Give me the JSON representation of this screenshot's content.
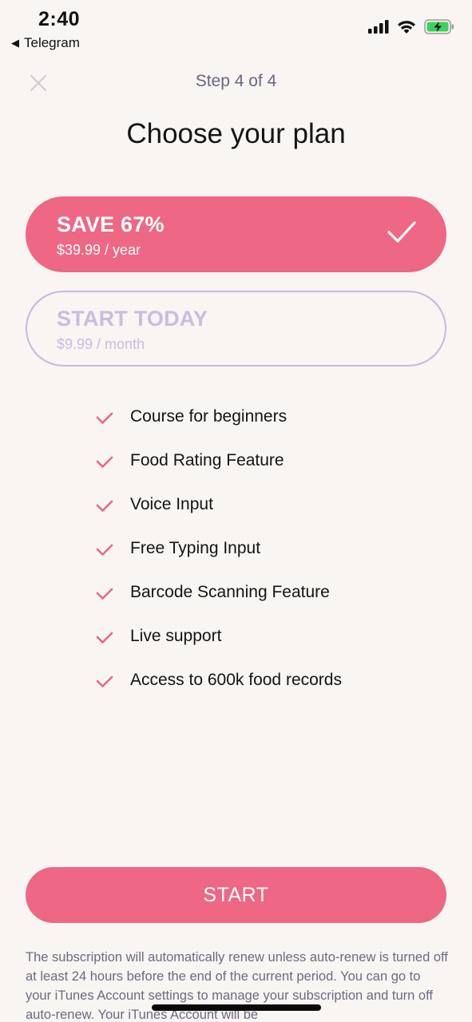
{
  "status_bar": {
    "time": "2:40",
    "back_app": "Telegram",
    "icons": [
      "cellular-signal-icon",
      "wifi-icon",
      "battery-charging-icon"
    ]
  },
  "header": {
    "step": "Step 4 of 4",
    "title": "Choose your plan"
  },
  "plans": [
    {
      "title": "SAVE 67%",
      "price": "$39.99 / year",
      "selected": true
    },
    {
      "title": "START TODAY",
      "price": "$9.99 / month",
      "selected": false
    }
  ],
  "features": [
    "Course for beginners",
    "Food Rating Feature",
    "Voice Input",
    "Free Typing Input",
    "Barcode Scanning Feature",
    "Live support",
    "Access to 600k food records"
  ],
  "cta": {
    "label": "START"
  },
  "legal": "The subscription will automatically renew unless auto-renew is turned off at least 24 hours before the end of the current period. You can go to your iTunes Account settings to manage your subscription and turn off auto-renew. Your iTunes Account will be",
  "colors": {
    "accent": "#ee6785",
    "outline": "#c6b8df",
    "background": "#f8f5f2",
    "muted_text": "#6c6a82"
  }
}
